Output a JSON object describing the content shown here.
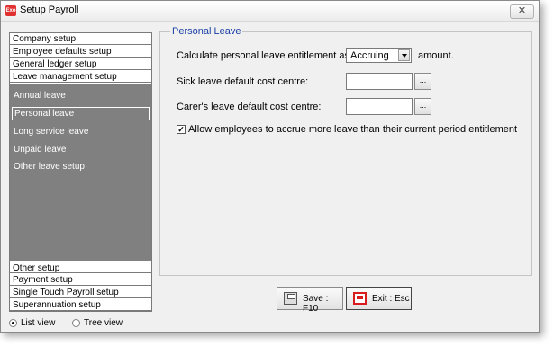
{
  "window": {
    "title": "Setup Payroll",
    "app_icon_text": "Exo",
    "close_glyph": "✕"
  },
  "sidebar": {
    "sections_top": [
      {
        "label": "Company setup"
      },
      {
        "label": "Employee defaults setup"
      },
      {
        "label": "General ledger setup"
      },
      {
        "label": "Leave management setup"
      }
    ],
    "leave_items": [
      {
        "label": "Annual leave"
      },
      {
        "label": "Personal leave",
        "selected": true
      },
      {
        "label": "Long service leave"
      },
      {
        "label": "Unpaid leave"
      },
      {
        "label": "Other leave setup"
      }
    ],
    "sections_bottom": [
      {
        "label": "Other setup"
      },
      {
        "label": "Payment setup"
      },
      {
        "label": "Single Touch Payroll setup"
      },
      {
        "label": "Superannuation setup"
      }
    ]
  },
  "view_toggle": {
    "list_label": "List view",
    "tree_label": "Tree view",
    "selected": "list"
  },
  "panel": {
    "title": "Personal Leave",
    "entitlement_label": "Calculate personal leave entitlement as:",
    "entitlement_value": "Accruing",
    "entitlement_suffix": "amount.",
    "sick_label": "Sick leave default cost centre:",
    "sick_value": "",
    "carer_label": "Carer's leave default cost centre:",
    "carer_value": "",
    "lookup_label": "...",
    "accrue_label": "Allow employees to accrue more leave than their current period entitlement",
    "accrue_checked": true,
    "check_glyph": "✓"
  },
  "buttons": {
    "save_label": "Save : F10",
    "exit_label": "Exit : Esc"
  }
}
